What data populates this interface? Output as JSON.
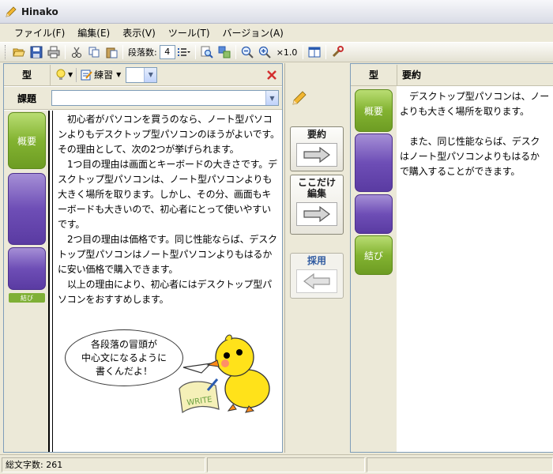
{
  "window": {
    "title": "Hinako"
  },
  "menu": [
    "ファイル(F)",
    "編集(E)",
    "表示(V)",
    "ツール(T)",
    "バージョン(A)"
  ],
  "toolbar": {
    "paragraph_label": "段落数:",
    "paragraph_count": "4",
    "zoom": "×1.0"
  },
  "left": {
    "type_header": "型",
    "mode_label": "練習",
    "task_label": "課題",
    "task_value": "",
    "type_buttons": [
      "概要",
      "",
      ""
    ],
    "small_tag": "結び",
    "paragraphs": [
      "初心者がパソコンを買うのなら、ノート型パソコンよりもデスクトップ型パソコンのほうがよいです。その理由として、次の2つが挙げられます。",
      "1つ目の理由は画面とキーボードの大きさです。デスクトップ型パソコンは、ノート型パソコンよりも大きく場所を取ります。しかし、その分、画面もキーボードも大きいので、初心者にとって使いやすいです。",
      "2つ目の理由は価格です。同じ性能ならば、デスクトップ型パソコンはノート型パソコンよりもはるかに安い価格で購入できます。",
      "以上の理由により、初心者にはデスクトップ型パソコンをおすすめします。"
    ],
    "speech_bubble": [
      "各段落の冒頭が",
      "中心文になるように",
      "書くんだよ！"
    ],
    "note_sign": "WRITE"
  },
  "middle": {
    "summarize_label": "要約",
    "edit_here_label": [
      "ここだけ",
      "編集"
    ],
    "adopt_label": "採用"
  },
  "right": {
    "type_header": "型",
    "summary_header": "要約",
    "type_buttons": [
      "概要",
      "",
      "",
      "結び"
    ],
    "paragraphs": [
      "デスクトップ型パソコンは、ノー",
      "よりも大きく場所を取ります。",
      "また、同じ性能ならば、デスク",
      "はノート型パソコンよりもはるか",
      "で購入することができます。"
    ]
  },
  "status": {
    "char_count": "総文字数: 261"
  },
  "colors": {
    "green": "#83b331",
    "purple": "#6e4eb6",
    "accent_red": "#d32f2f"
  }
}
